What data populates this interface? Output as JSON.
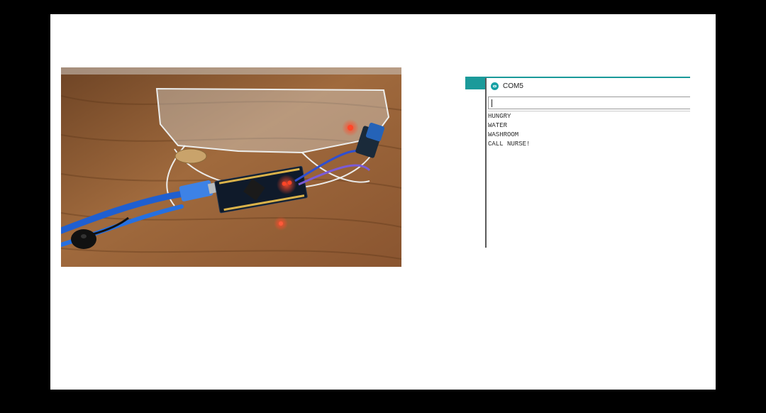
{
  "serial_monitor": {
    "window_title": "COM5",
    "input_value": "",
    "output_lines": [
      "HUNGRY",
      "WATER",
      "WASHROOM",
      "CALL NURSE!"
    ]
  },
  "colors": {
    "background": "#000000",
    "slide": "#ffffff",
    "accent_teal": "#1b9a9a",
    "led_red": "#ff2a1a",
    "cable_blue": "#1f5fd0"
  },
  "icons": {
    "window_icon": "arduino-icon"
  }
}
